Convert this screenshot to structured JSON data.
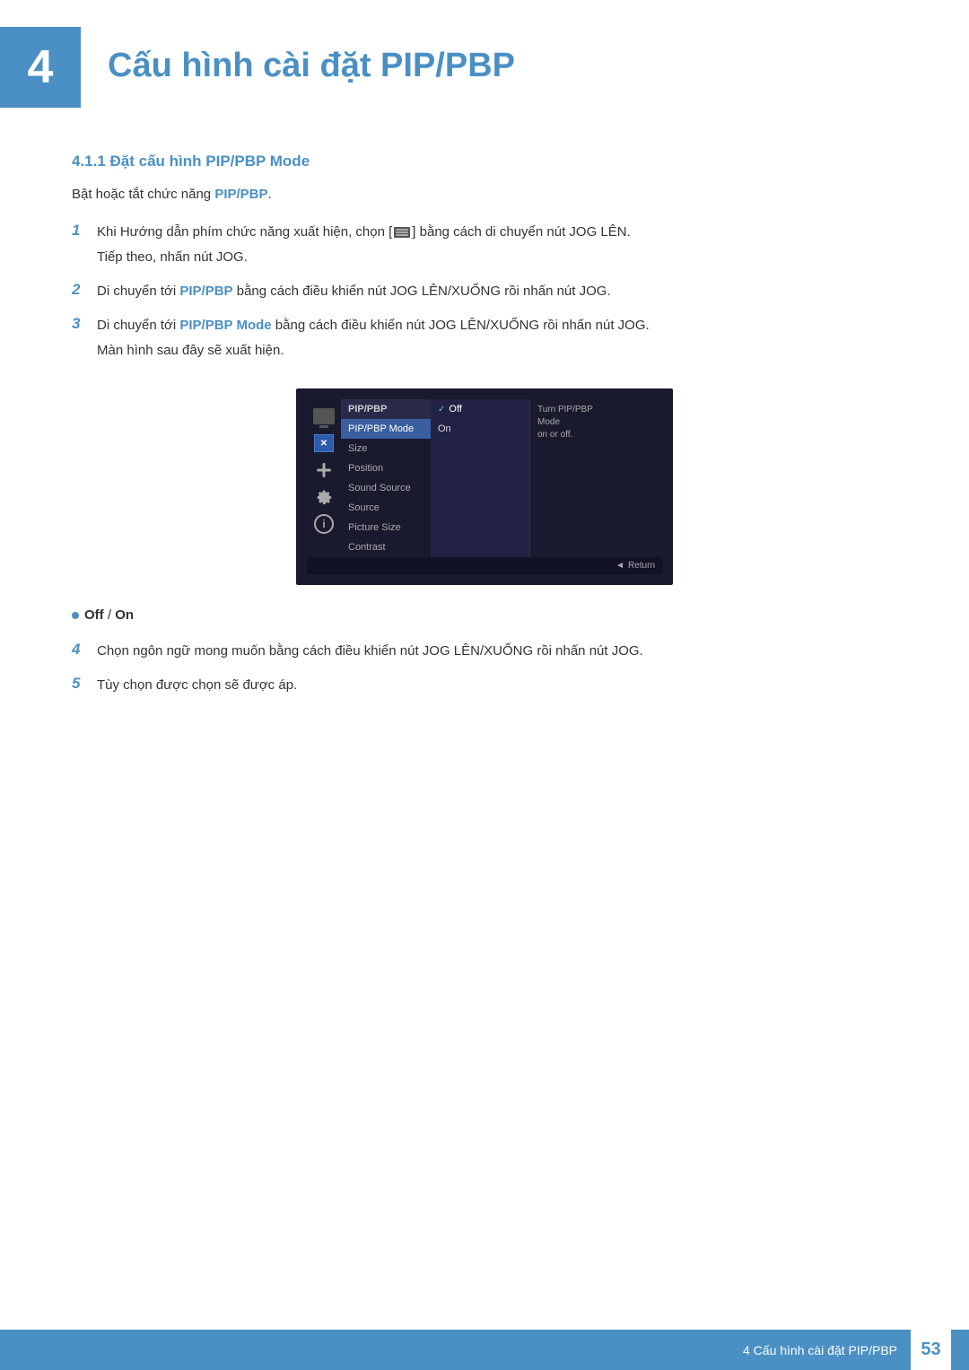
{
  "chapter": {
    "number": "4",
    "title": "Cấu hình cài đặt PIP/PBP"
  },
  "section": {
    "id": "4.1.1",
    "heading": "4.1.1  Đặt cấu hình PIP/PBP Mode"
  },
  "intro": {
    "text": "Bật hoặc tắt chức năng ",
    "highlight": "PIP/PBP",
    "text2": "."
  },
  "steps": [
    {
      "number": "1",
      "text": "Khi Hướng dẫn phím chức năng xuất hiện, chọn [",
      "icon_hint": "grid-icon",
      "text2": "] bằng cách di chuyển nút JOG LÊN.",
      "sub": "Tiếp theo, nhấn nút JOG."
    },
    {
      "number": "2",
      "text": "Di chuyển tới ",
      "bold": "PIP/PBP",
      "text2": " bằng cách điều khiển nút JOG LÊN/XUỐNG rồi nhấn nút JOG."
    },
    {
      "number": "3",
      "text": "Di chuyển tới ",
      "bold": "PIP/PBP Mode",
      "text2": " bằng cách điều khiển nút JOG LÊN/XUỐNG rồi nhấn nút JOG.",
      "sub": "Màn hình sau đây sẽ xuất hiện."
    }
  ],
  "menu": {
    "title": "PIP/PBP",
    "items": [
      "PIP/PBP Mode",
      "Size",
      "Position",
      "Sound Source",
      "Source",
      "Picture Size",
      "Contrast"
    ],
    "active_item": "PIP/PBP Mode",
    "subitems": [
      {
        "label": "Off",
        "selected": true
      },
      {
        "label": "On",
        "selected": false
      }
    ],
    "help_title": "Turn PIP/PBP Mode",
    "help_text": "on or off.",
    "return_label": "Return"
  },
  "bullet_options": {
    "label": "Off / On",
    "off": "Off",
    "on": "On"
  },
  "steps_continued": [
    {
      "number": "4",
      "text": "Chọn ngôn ngữ mong muốn bằng cách điều khiển nút JOG LÊN/XUỐNG rồi nhấn nút JOG."
    },
    {
      "number": "5",
      "text": "Tùy chọn được chọn sẽ được áp."
    }
  ],
  "footer": {
    "text": "4 Cấu hình cài đặt PIP/PBP",
    "page": "53"
  }
}
